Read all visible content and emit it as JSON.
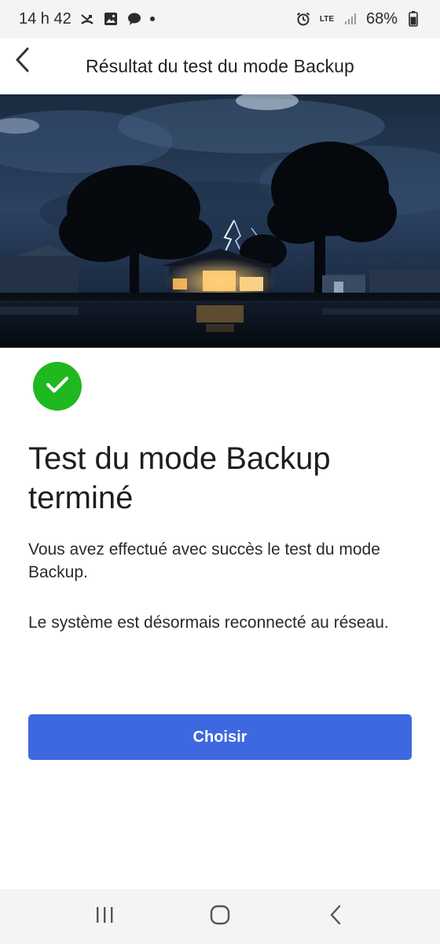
{
  "status_bar": {
    "time": "14 h 42",
    "network": "LTE",
    "battery": "68%"
  },
  "header": {
    "title": "Résultat du test du mode Backup"
  },
  "content": {
    "heading": "Test du mode Backup terminé",
    "paragraph1": "Vous avez effectué avec succès le test du mode Backup.",
    "paragraph2": "Le système est désormais reconnecté au réseau."
  },
  "actions": {
    "primary_label": "Choisir"
  },
  "colors": {
    "accent": "#3d68df",
    "success": "#1fb81f"
  },
  "icons": {
    "back": "chevron-left-icon",
    "success": "checkmark-icon",
    "recent_apps": "recent-apps-icon",
    "home": "home-icon",
    "nav_back": "nav-back-icon"
  }
}
